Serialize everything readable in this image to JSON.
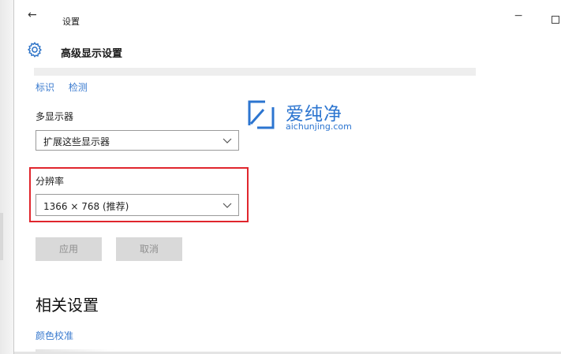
{
  "titlebar": {
    "back_glyph": "←",
    "app_title": "设置",
    "minimize_glyph": "−"
  },
  "header": {
    "icon": "gear-icon",
    "page_title": "高级显示设置"
  },
  "links": {
    "identify": "标识",
    "detect": "检测"
  },
  "multiple_displays": {
    "label": "多显示器",
    "selected": "扩展这些显示器"
  },
  "resolution": {
    "label": "分辨率",
    "selected": "1366 × 768 (推荐)",
    "highlight_color": "#e0262d"
  },
  "buttons": {
    "apply": "应用",
    "cancel": "取消"
  },
  "related": {
    "title": "相关设置",
    "color_calibration": "颜色校准"
  },
  "watermark": {
    "name": "爱纯净",
    "url": "aichunjing.com",
    "color": "#2c75d0"
  },
  "colors": {
    "accent_link": "#3b7bcf",
    "disabled_button": "#d9d9d9"
  }
}
